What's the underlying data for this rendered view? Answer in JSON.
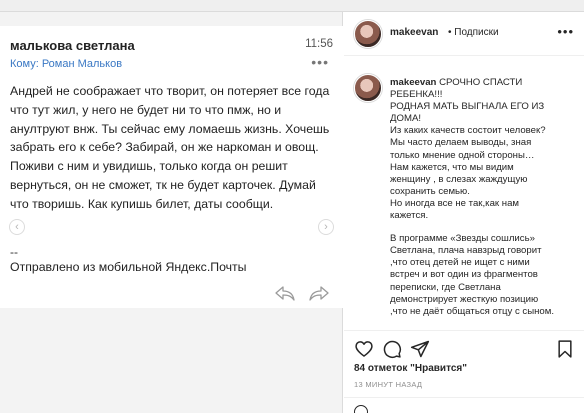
{
  "email": {
    "sender": "малькова светлана",
    "time": "11:56",
    "to": "Кому: Роман Мальков",
    "more": "•••",
    "body": "Андрей не соображает что творит, он потеряет все года что тут жил, у него не будет ни то что пмж, но и анултруют внж. Ты сейчас ему ломаешь жизнь. Хочешь забрать его к себе? Забирай, он же наркоман и овощ. Поживи с ним и увидишь, только когда он решит вернуться, он не сможет, тк не будет карточек. Думай что творишь. Как купишь билет, даты сообщи.",
    "sig_dash": "--",
    "signature": "Отправлено из мобильной Яндекс.Почты"
  },
  "post": {
    "username": "makeevan",
    "follow": "• Подписки",
    "more": "•••",
    "caption_user": "makeevan",
    "caption_lines": [
      "СРОЧНО СПАСТИ",
      "РЕБЕНКА!!!",
      "РОДНАЯ МАТЬ ВЫГНАЛА ЕГО ИЗ",
      "ДОМА!",
      "Из каких качеств состоит человек?",
      "Мы часто делаем выводы, зная",
      "только мнение одной стороны…",
      "Нам кажется, что мы видим",
      "женщину , в слезах жаждущую",
      "сохранить семью.",
      "Но иногда все не так,как нам",
      "кажется.",
      "",
      "В программе «Звезды сошлись»",
      "Светлана, плача навзрыд говорит",
      ",что отец детей не ищет с ними",
      "встреч и вот один из фрагментов",
      "переписки, где Светлана",
      "демонстрирует жесткую позицию",
      ",что не даёт общаться отцу с сыном."
    ],
    "likes": "84 отметок \"Нравится\"",
    "ago": "13 МИНУТ НАЗАД"
  },
  "icons": {
    "like": "heart-icon",
    "comment": "comment-icon",
    "share": "share-icon",
    "save": "bookmark-icon",
    "reply": "reply-icon",
    "forward": "forward-icon"
  }
}
